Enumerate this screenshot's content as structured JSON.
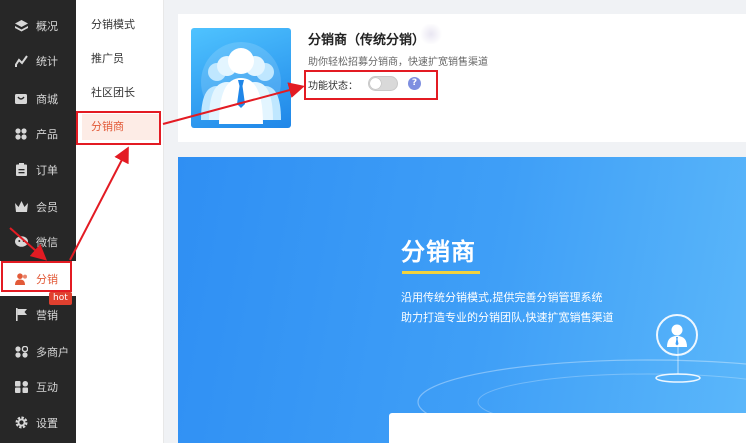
{
  "sidebar": {
    "items": [
      {
        "label": "概况",
        "icon": "layers-icon"
      },
      {
        "label": "统计",
        "icon": "chart-icon"
      },
      {
        "label": "商城",
        "icon": "store-icon"
      },
      {
        "label": "产品",
        "icon": "grid-icon"
      },
      {
        "label": "订单",
        "icon": "clipboard-icon"
      },
      {
        "label": "会员",
        "icon": "crown-icon"
      },
      {
        "label": "微信",
        "icon": "wechat-icon"
      },
      {
        "label": "分销",
        "icon": "users-icon"
      },
      {
        "label": "营销",
        "icon": "flag-icon"
      },
      {
        "label": "多商户",
        "icon": "merchant-icon"
      },
      {
        "label": "互动",
        "icon": "interact-icon"
      },
      {
        "label": "设置",
        "icon": "gear-icon"
      }
    ],
    "hot_badge": "hot",
    "active_color": "#e25a38"
  },
  "subnav": {
    "items": [
      {
        "label": "分销模式"
      },
      {
        "label": "推广员"
      },
      {
        "label": "社区团长"
      },
      {
        "label": "分销商"
      }
    ]
  },
  "plugin": {
    "title": "分销商（传统分销）",
    "subtitle": "助你轻松招募分销商，快速扩宽销售渠道",
    "status_label": "功能状态：",
    "status_on": false,
    "help": "?"
  },
  "banner": {
    "title": "分销商",
    "line1": "沿用传统分销模式,提供完善分销管理系统",
    "line2": "助力打造专业的分销团队,快速扩宽销售渠道",
    "accent": "#f2d23d"
  },
  "annotation_color": "#e31b23"
}
